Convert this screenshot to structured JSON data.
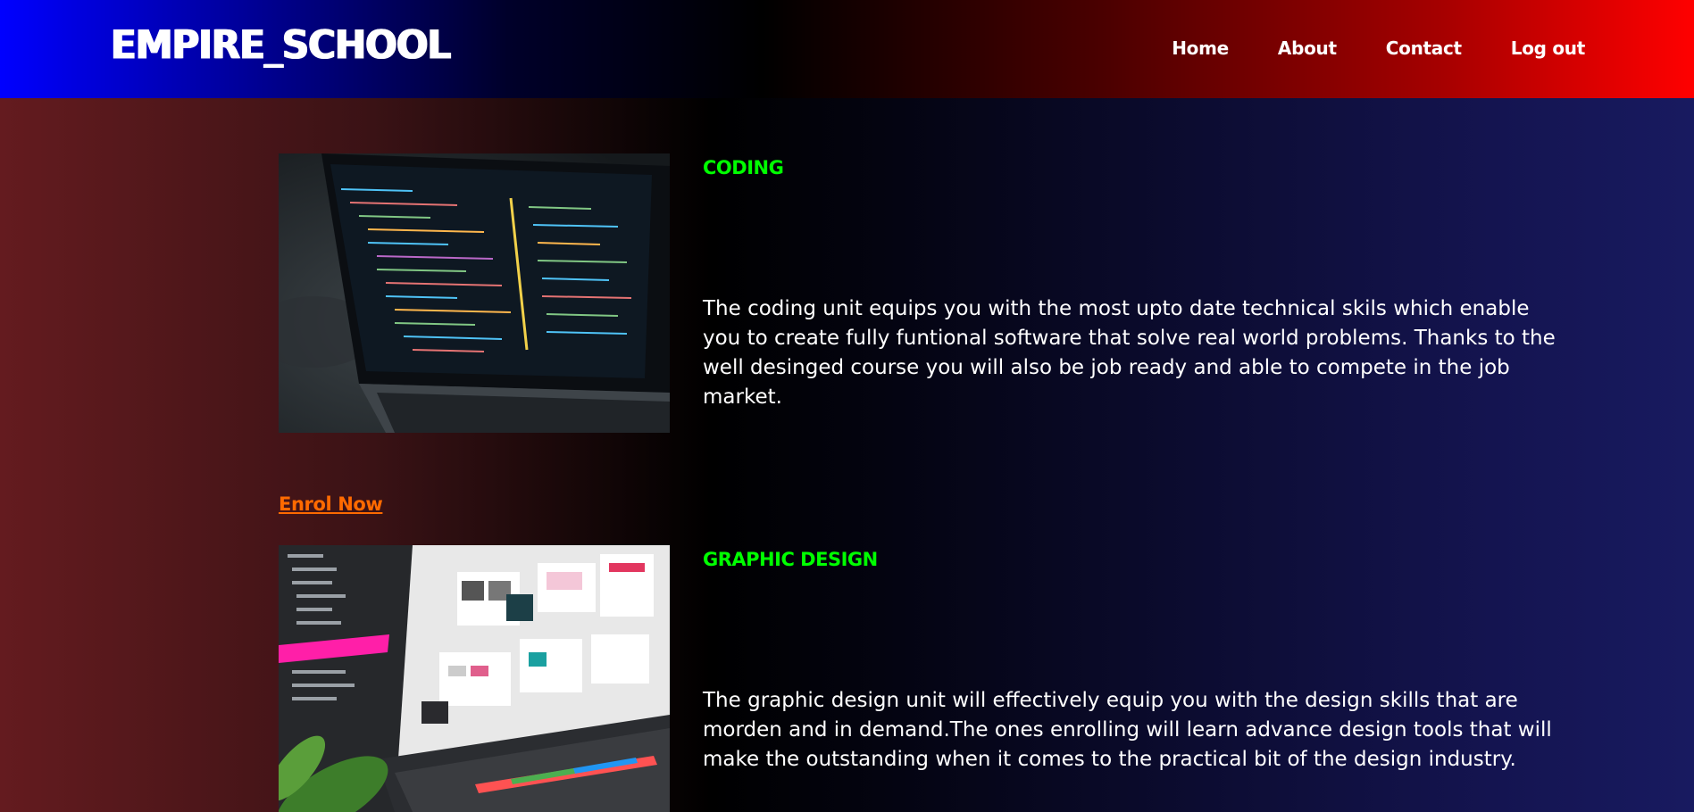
{
  "header": {
    "brand": "EMPIRE_SCHOOL",
    "nav": [
      {
        "label": "Home"
      },
      {
        "label": "About"
      },
      {
        "label": "Contact"
      },
      {
        "label": "Log out"
      }
    ]
  },
  "courses": [
    {
      "title": "CODING",
      "description": "The coding unit equips you with the most upto date technical skils which enable you to create fully funtional software that solve real world problems. Thanks to the well desinged course you will also be job ready and able to compete in the job market.",
      "image": "laptop-code-photo"
    },
    {
      "title": "GRAPHIC DESIGN",
      "description": "The graphic design unit will effectively equip you with the design skills that are morden and in demand.The ones enrolling will learn advance design tools that will make the outstanding when it comes to the practical bit of the design industry.",
      "image": "laptop-design-photo"
    }
  ],
  "enrol_label": "Enrol Now",
  "colors": {
    "title_accent": "#00ff00",
    "enrol_link": "#ff6a00",
    "nav_left": "#0000ff",
    "nav_right": "#ff0000"
  }
}
